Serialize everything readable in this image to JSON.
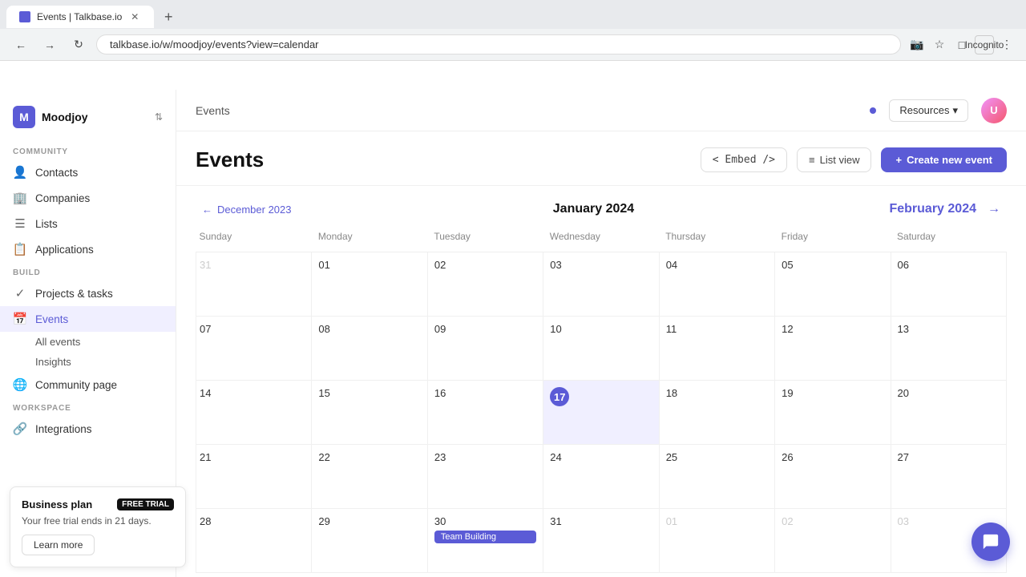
{
  "browser": {
    "tab_title": "Events | Talkbase.io",
    "url": "talkbase.io/w/moodjoy/events?view=calendar",
    "new_tab_label": "+"
  },
  "sidebar": {
    "org_name": "Moodjoy",
    "community_label": "COMMUNITY",
    "build_label": "BUILD",
    "workspace_label": "WORKSPACE",
    "nav_items_community": [
      {
        "label": "Contacts",
        "icon": "👤"
      },
      {
        "label": "Companies",
        "icon": "🏢"
      },
      {
        "label": "Lists",
        "icon": "☰"
      },
      {
        "label": "Applications",
        "icon": "📋"
      }
    ],
    "nav_items_build": [
      {
        "label": "Projects & tasks",
        "icon": "✓"
      },
      {
        "label": "Events",
        "icon": "📅",
        "active": true
      }
    ],
    "events_sub": [
      {
        "label": "All events"
      },
      {
        "label": "Insights"
      }
    ],
    "nav_items_community2": [
      {
        "label": "Community page",
        "icon": "🌐"
      }
    ],
    "workspace_items": [
      {
        "label": "Integrations",
        "icon": "🔗"
      }
    ]
  },
  "banner": {
    "title": "Business plan",
    "badge": "FREE TRIAL",
    "text": "Your free trial ends in 21 days.",
    "btn_label": "Learn more"
  },
  "header": {
    "title": "Events",
    "resources_label": "Resources",
    "embed_label": "< Embed />",
    "list_view_label": "List view",
    "create_label": "Create new event"
  },
  "calendar": {
    "prev_month": "December 2023",
    "current_month": "January 2024",
    "next_month": "February 2024",
    "days_of_week": [
      "Sunday",
      "Monday",
      "Tuesday",
      "Wednesday",
      "Thursday",
      "Friday",
      "Saturday"
    ],
    "weeks": [
      [
        {
          "num": "31",
          "other": true
        },
        {
          "num": "01"
        },
        {
          "num": "02"
        },
        {
          "num": "03"
        },
        {
          "num": "04"
        },
        {
          "num": "05"
        },
        {
          "num": "06"
        }
      ],
      [
        {
          "num": "07"
        },
        {
          "num": "08"
        },
        {
          "num": "09"
        },
        {
          "num": "10"
        },
        {
          "num": "11"
        },
        {
          "num": "12"
        },
        {
          "num": "13"
        }
      ],
      [
        {
          "num": "14"
        },
        {
          "num": "15"
        },
        {
          "num": "16"
        },
        {
          "num": "17",
          "today": true
        },
        {
          "num": "18"
        },
        {
          "num": "19"
        },
        {
          "num": "20"
        }
      ],
      [
        {
          "num": "21"
        },
        {
          "num": "22"
        },
        {
          "num": "23"
        },
        {
          "num": "24"
        },
        {
          "num": "25"
        },
        {
          "num": "26"
        },
        {
          "num": "27"
        }
      ],
      [
        {
          "num": "28"
        },
        {
          "num": "29"
        },
        {
          "num": "30"
        },
        {
          "num": "31"
        },
        {
          "num": "01",
          "other": true
        },
        {
          "num": "02",
          "other": true
        },
        {
          "num": "03",
          "other": true
        }
      ]
    ],
    "event_30": "Team Building"
  }
}
